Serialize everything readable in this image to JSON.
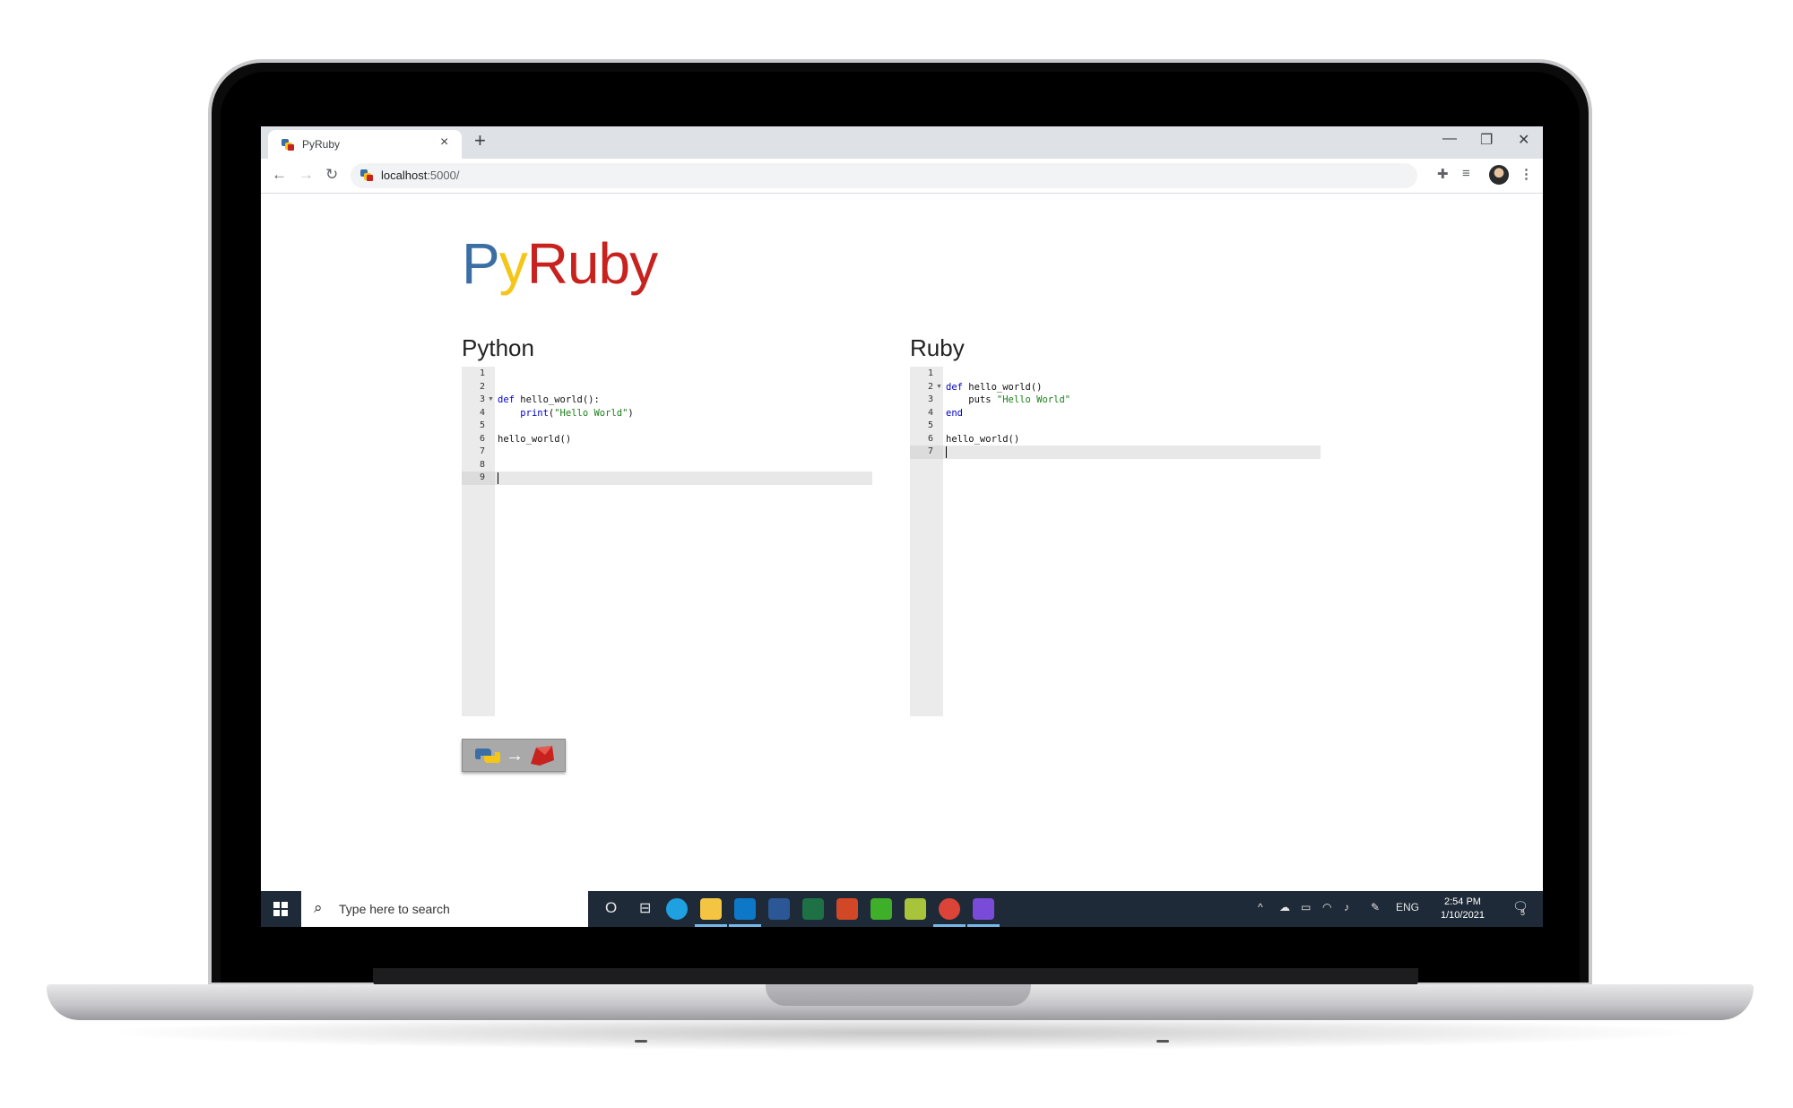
{
  "browser": {
    "tab_title": "PyRuby",
    "tab_close": "×",
    "new_tab": "+",
    "minimize": "—",
    "restore": "❐",
    "close": "✕",
    "url_host": "localhost",
    "url_path": ":5000/",
    "nav_back": "←",
    "nav_forward": "→",
    "nav_reload": "↻"
  },
  "page": {
    "logo": {
      "p": "P",
      "y": "y",
      "r": "Ruby"
    },
    "python": {
      "title": "Python",
      "lines": [
        {
          "n": "1",
          "parts": []
        },
        {
          "n": "2",
          "parts": []
        },
        {
          "n": "3",
          "fold": true,
          "parts": [
            {
              "cls": "kw",
              "t": "def "
            },
            {
              "cls": "txt",
              "t": "hello_world():"
            }
          ]
        },
        {
          "n": "4",
          "parts": [
            {
              "cls": "txt",
              "t": "    "
            },
            {
              "cls": "kw",
              "t": "print"
            },
            {
              "cls": "txt",
              "t": "("
            },
            {
              "cls": "str",
              "t": "\"Hello World\""
            },
            {
              "cls": "txt",
              "t": ")"
            }
          ]
        },
        {
          "n": "5",
          "parts": []
        },
        {
          "n": "6",
          "parts": [
            {
              "cls": "txt",
              "t": "hello_world()"
            }
          ]
        },
        {
          "n": "7",
          "parts": []
        },
        {
          "n": "8",
          "parts": []
        },
        {
          "n": "9",
          "parts": []
        }
      ],
      "active_line": 9
    },
    "ruby": {
      "title": "Ruby",
      "lines": [
        {
          "n": "1",
          "parts": []
        },
        {
          "n": "2",
          "fold": true,
          "parts": [
            {
              "cls": "kw",
              "t": "def "
            },
            {
              "cls": "txt",
              "t": "hello_world()"
            }
          ]
        },
        {
          "n": "3",
          "parts": [
            {
              "cls": "txt",
              "t": "    puts "
            },
            {
              "cls": "str",
              "t": "\"Hello World\""
            }
          ]
        },
        {
          "n": "4",
          "parts": [
            {
              "cls": "kw",
              "t": "end"
            }
          ]
        },
        {
          "n": "5",
          "parts": []
        },
        {
          "n": "6",
          "parts": [
            {
              "cls": "txt",
              "t": "hello_world()"
            }
          ]
        },
        {
          "n": "7",
          "parts": []
        }
      ],
      "active_line": 7
    },
    "convert_button_arrow": "→"
  },
  "taskbar": {
    "search_placeholder": "Type here to search",
    "search_icon": "magnifier-icon",
    "cortana": "O",
    "time": "2:54 PM",
    "date": "1/10/2021",
    "lang": "ENG",
    "notifications": "5",
    "apps": [
      {
        "name": "edge",
        "color": "#1fa0e0"
      },
      {
        "name": "file-explorer",
        "color": "#f4c542"
      },
      {
        "name": "vscode",
        "color": "#0e78c8"
      },
      {
        "name": "word",
        "color": "#2b5797"
      },
      {
        "name": "excel",
        "color": "#1e7145"
      },
      {
        "name": "powerpoint",
        "color": "#d24726"
      },
      {
        "name": "camtasia",
        "color": "#3fae29"
      },
      {
        "name": "tennis",
        "color": "#a8c43a"
      },
      {
        "name": "chrome",
        "color": "#db4437"
      },
      {
        "name": "paint-drop",
        "color": "#7a4bd8"
      }
    ]
  }
}
